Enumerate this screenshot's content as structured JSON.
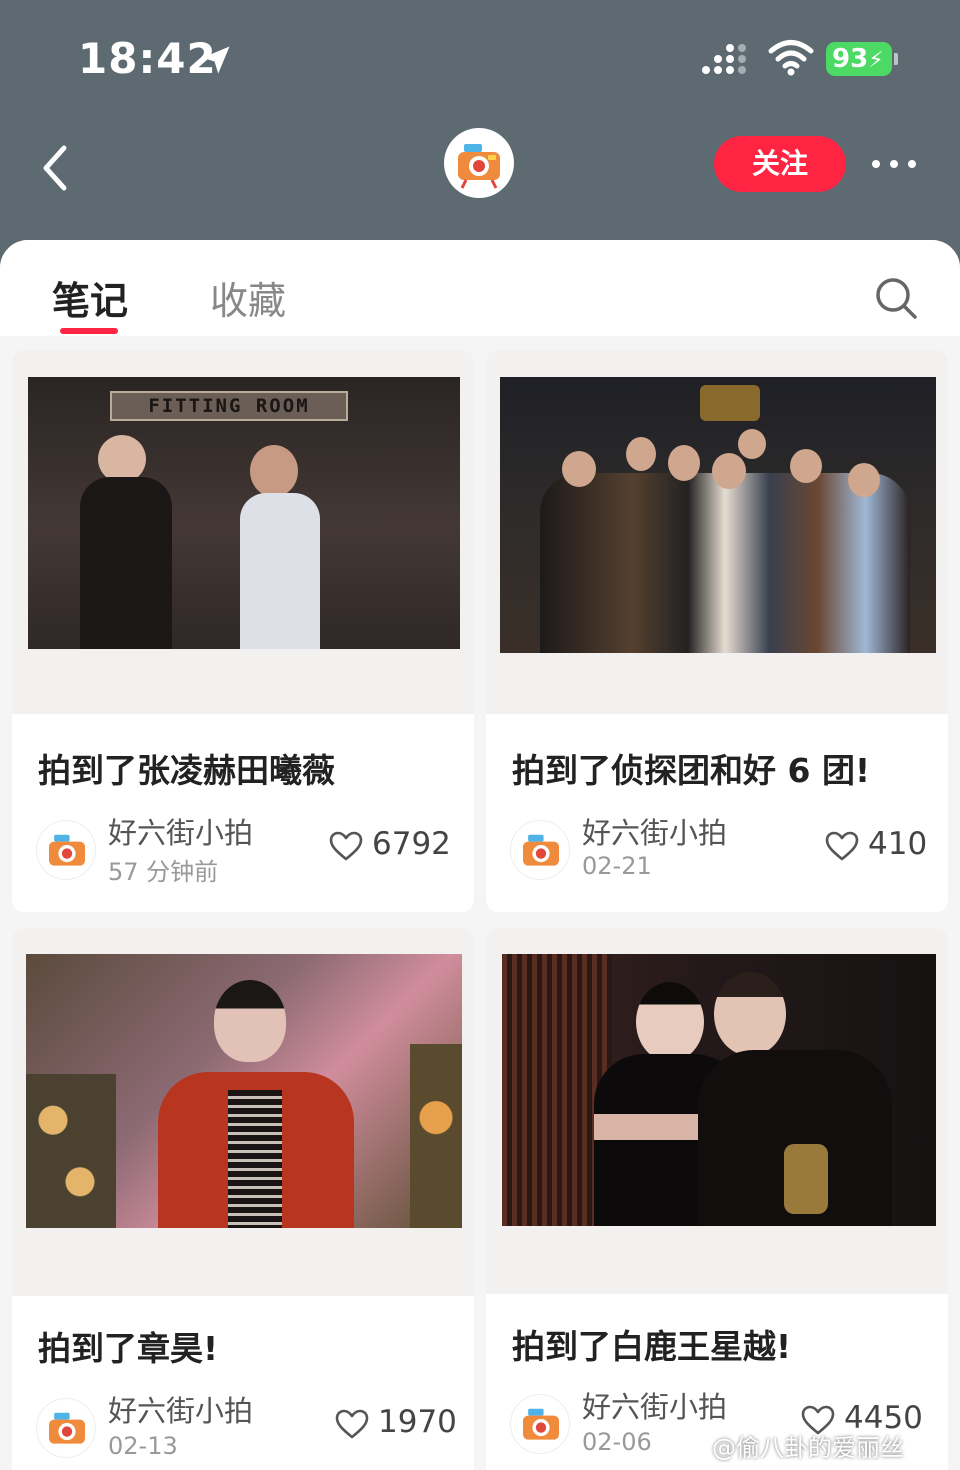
{
  "status_bar": {
    "time": "18:42",
    "battery": "93"
  },
  "nav": {
    "follow_label": "关注"
  },
  "tabs": [
    {
      "label": "笔记",
      "active": true
    },
    {
      "label": "收藏",
      "active": false
    }
  ],
  "notes": [
    {
      "title": "拍到了张凌赫田曦薇",
      "author": "好六街小拍",
      "date": "57 分钟前",
      "likes": "6792",
      "photo_sign": "FITTING ROOM"
    },
    {
      "title": "拍到了侦探团和好 6 团!",
      "author": "好六街小拍",
      "date": "02-21",
      "likes": "410"
    },
    {
      "title": "拍到了章昊!",
      "author": "好六街小拍",
      "date": "02-13",
      "likes": "1970"
    },
    {
      "title": "拍到了白鹿王星越!",
      "author": "好六街小拍",
      "date": "02-06",
      "likes": "4450"
    }
  ],
  "watermark": "@偷八卦的爱丽丝",
  "colors": {
    "accent": "#ff2442",
    "header_bg": "#5d6a72",
    "battery": "#4cd964"
  }
}
